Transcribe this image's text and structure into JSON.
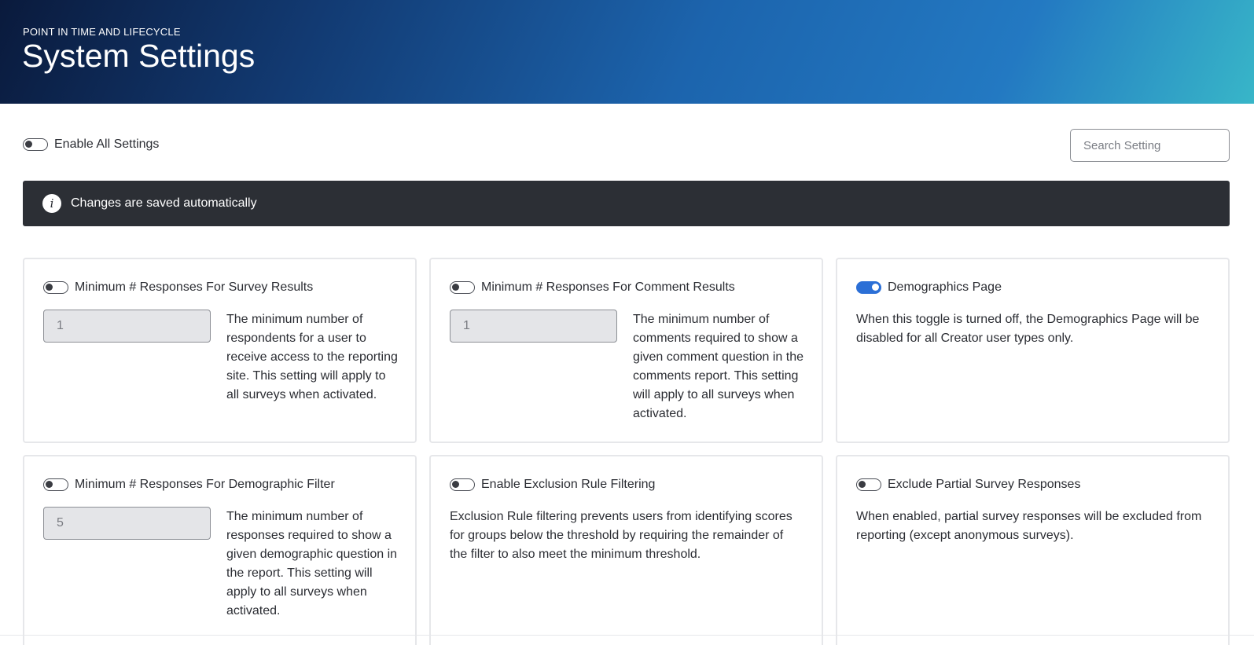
{
  "header": {
    "subtitle": "POINT IN TIME AND LIFECYCLE",
    "title": "System Settings"
  },
  "toolbar": {
    "enable_all_label": "Enable All Settings",
    "enable_all_on": false,
    "search_placeholder": "Search Setting"
  },
  "banner": {
    "text": "Changes are saved automatically",
    "icon": "info-icon"
  },
  "colors": {
    "header_start": "#0a1a3c",
    "header_end": "#38b6c8",
    "toggle_on": "#2b6fd6",
    "banner_bg": "#2c2f35"
  },
  "settings": [
    {
      "title": "Minimum # Responses For Survey Results",
      "enabled": false,
      "value": "1",
      "description": "The minimum number of respondents for a user to receive access to the reporting site. This setting will apply to all surveys when activated."
    },
    {
      "title": "Minimum # Responses For Comment Results",
      "enabled": false,
      "value": "1",
      "description": "The minimum number of comments required to show a given comment question in the comments report. This setting will apply to all surveys when activated."
    },
    {
      "title": "Demographics Page",
      "enabled": true,
      "description": "When this toggle is turned off, the Demographics Page will be disabled for all Creator user types only."
    },
    {
      "title": "Minimum # Responses For Demographic Filter",
      "enabled": false,
      "value": "5",
      "description": "The minimum number of responses required to show a given demographic question in the report. This setting will apply to all surveys when activated."
    },
    {
      "title": "Enable Exclusion Rule Filtering",
      "enabled": false,
      "description": "Exclusion Rule filtering prevents users from identifying scores for groups below the threshold by requiring the remainder of the filter to also meet the minimum threshold."
    },
    {
      "title": "Exclude Partial Survey Responses",
      "enabled": false,
      "description": "When enabled, partial survey responses will be excluded from reporting (except anonymous surveys)."
    }
  ]
}
